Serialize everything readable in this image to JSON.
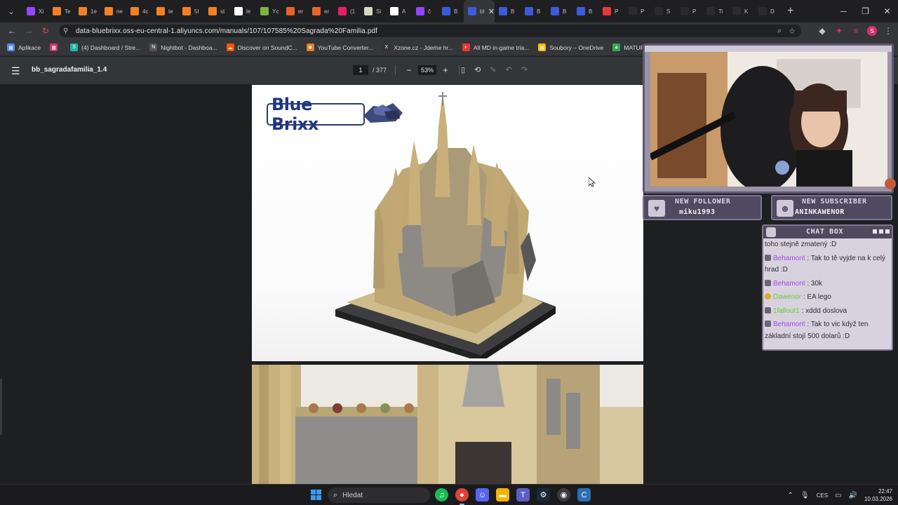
{
  "browser": {
    "tabs": [
      {
        "label": "Xi",
        "color": "#9146ff",
        "glyph": ""
      },
      {
        "label": "Te",
        "color": "#f48024",
        "glyph": ""
      },
      {
        "label": "1e",
        "color": "#f48024",
        "glyph": ""
      },
      {
        "label": "ne",
        "color": "#f48024",
        "glyph": ""
      },
      {
        "label": "4c",
        "color": "#f48024",
        "glyph": ""
      },
      {
        "label": "te",
        "color": "#f48024",
        "glyph": ""
      },
      {
        "label": "5l",
        "color": "#f48024",
        "glyph": ""
      },
      {
        "label": "st",
        "color": "#f48024",
        "glyph": ""
      },
      {
        "label": "le",
        "color": "#ffffff",
        "glyph": "G"
      },
      {
        "label": "Yc",
        "color": "#7cb342",
        "glyph": ""
      },
      {
        "label": "er",
        "color": "#e8632b",
        "glyph": ""
      },
      {
        "label": "er",
        "color": "#e8632b",
        "glyph": ""
      },
      {
        "label": "(1",
        "color": "#e91e63",
        "glyph": ""
      },
      {
        "label": "Si",
        "color": "#d9d9c0",
        "glyph": ""
      },
      {
        "label": "A",
        "color": "#ffffff",
        "glyph": ""
      },
      {
        "label": "č",
        "color": "#9146ff",
        "glyph": ""
      },
      {
        "label": "B",
        "color": "#3b5bdb",
        "glyph": ""
      },
      {
        "label": "bl",
        "color": "#3b5bdb",
        "glyph": ""
      },
      {
        "label": "B",
        "color": "#3b5bdb",
        "glyph": ""
      },
      {
        "label": "B",
        "color": "#3b5bdb",
        "glyph": ""
      },
      {
        "label": "B",
        "color": "#3b5bdb",
        "glyph": ""
      },
      {
        "label": "B",
        "color": "#3b5bdb",
        "glyph": ""
      },
      {
        "label": "P",
        "color": "#e53935",
        "glyph": ""
      },
      {
        "label": "P",
        "color": "#2b2b2b",
        "glyph": ""
      },
      {
        "label": "S",
        "color": "#2b2b2b",
        "glyph": ""
      },
      {
        "label": "P",
        "color": "#2b2b2b",
        "glyph": ""
      },
      {
        "label": "Ti",
        "color": "#2b2b2b",
        "glyph": ""
      },
      {
        "label": "K",
        "color": "#2b2b2b",
        "glyph": ""
      },
      {
        "label": "D",
        "color": "#2b2b2b",
        "glyph": ""
      }
    ],
    "active_tab_index": 17,
    "new_tab": "+",
    "url": "data-bluebrixx.oss-eu-central-1.aliyuncs.com/manuals/107/107585%20Sagrada%20Familia.pdf",
    "bookmarks": [
      {
        "label": "Aplikace",
        "color": "#4a8af4",
        "glyph": "▦"
      },
      {
        "label": "",
        "color": "#d6336c",
        "glyph": "▦"
      },
      {
        "label": "(4) Dashboard / Stre...",
        "color": "#1fb6a8",
        "glyph": "S"
      },
      {
        "label": "Nightbot - Dashboa...",
        "color": "#555555",
        "glyph": "N"
      },
      {
        "label": "Discover on SoundC...",
        "color": "#ff5500",
        "glyph": "☁"
      },
      {
        "label": "YouTube Converter...",
        "color": "#e67e22",
        "glyph": "✱"
      },
      {
        "label": "Xzone.cz - Jdeme hr...",
        "color": "#333333",
        "glyph": "X"
      },
      {
        "label": "All MD in-game tria...",
        "color": "#e53935",
        "glyph": "◐"
      },
      {
        "label": "Soubory – OneDrive",
        "color": "#ffb900",
        "glyph": "▦"
      },
      {
        "label": "MATURITA_OKRUH...",
        "color": "#34a853",
        "glyph": "▲"
      }
    ]
  },
  "pdf": {
    "title": "bb_sagradafamilia_1.4",
    "page_current": "1",
    "page_total": "/ 377",
    "zoom": "53%",
    "logo_text": "Blue Brixx"
  },
  "stream": {
    "follower_label": "NEW FOLLOWER",
    "follower_value": "miku1993",
    "subscriber_label": "NEW SUBSCRIBER",
    "subscriber_value": "ANINKAWENOR",
    "chat_title": "CHAT BOX",
    "chat": [
      {
        "user": "",
        "text": "toho stejně zmatený :D",
        "user_class": ""
      },
      {
        "user": "Behamont",
        "text": " : Tak to tě vyjde na k celý hrad :D",
        "user_class": "u-purple"
      },
      {
        "user": "Behamont",
        "text": " : 30k",
        "user_class": "u-purple"
      },
      {
        "user": "Dawenor",
        "text": " : EA lego",
        "user_class": "u-green"
      },
      {
        "user": "1fallout1",
        "text": " : xddd doslova",
        "user_class": "u-green"
      },
      {
        "user": "Behamont",
        "text": " : Tak to vic když ten základní stojí 500 dolarů :D",
        "user_class": "u-purple"
      }
    ]
  },
  "taskbar": {
    "search_label": "Hledat",
    "language": "CES",
    "time": "22:47",
    "date": "10.03.2026"
  }
}
